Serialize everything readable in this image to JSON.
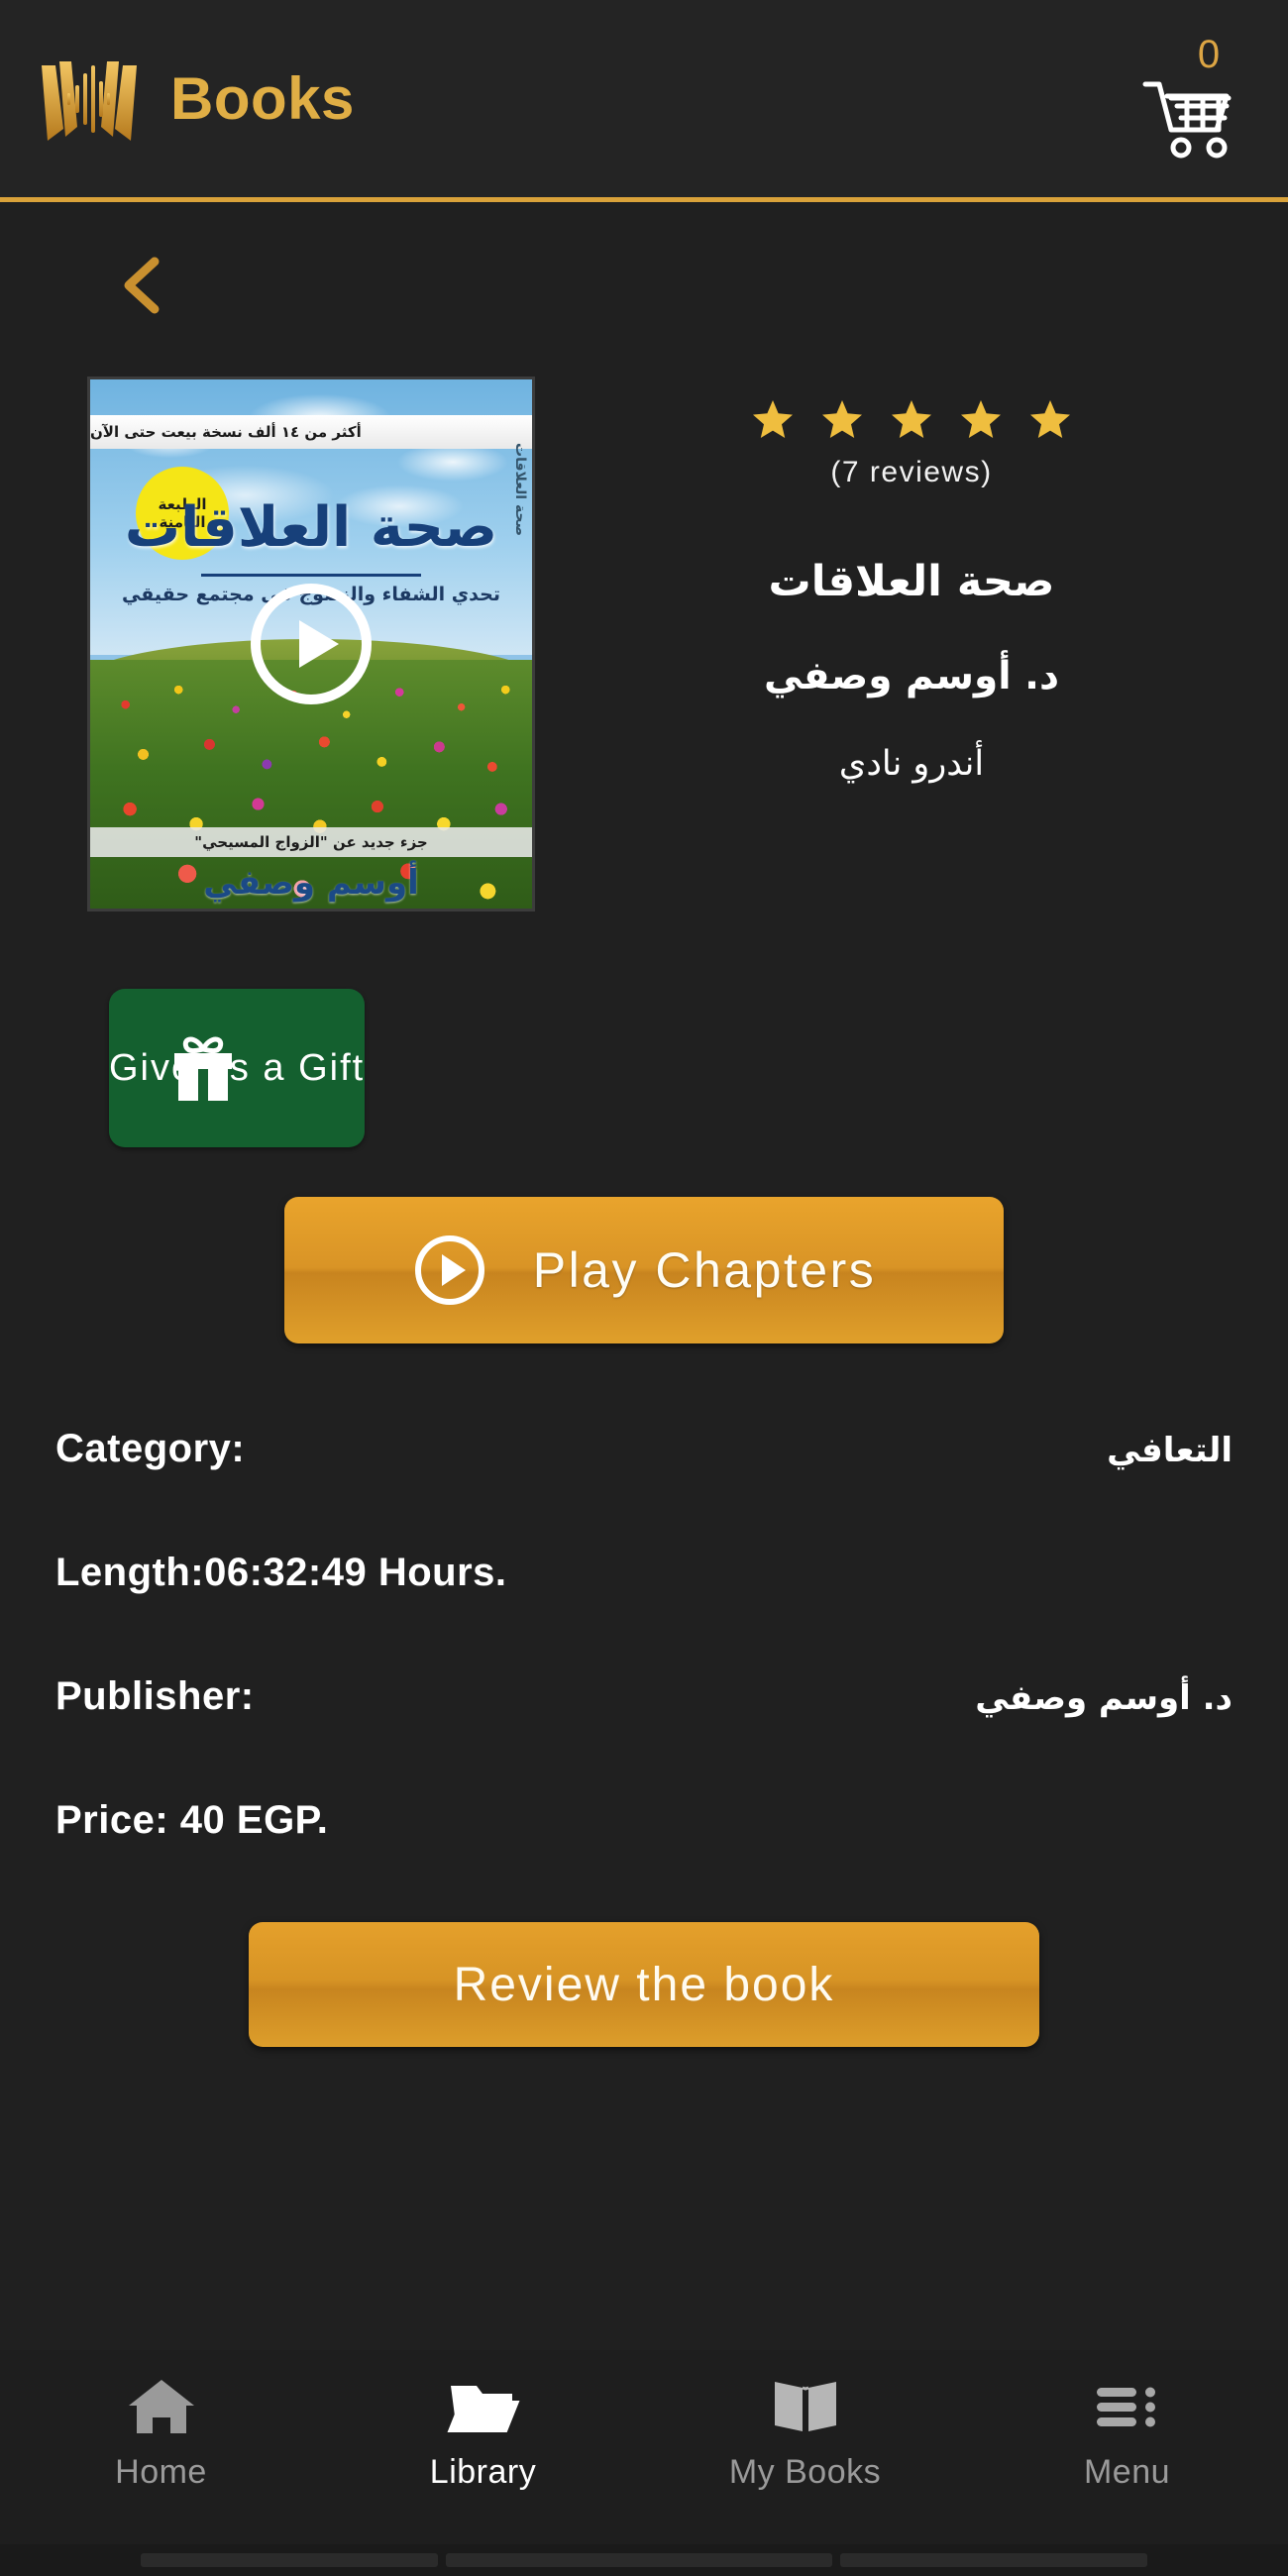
{
  "header": {
    "brand_title": "Books",
    "logo_icon": "open-book-audio-waveform-icon",
    "cart_icon": "shopping-cart-icon",
    "cart_count": "0",
    "accent_color": "#d9a23a",
    "brand_color": "#e0ae45"
  },
  "nav": {
    "back_icon": "chevron-left-icon"
  },
  "cover": {
    "play_overlay_icon": "play-circle-icon",
    "top_banner_ar": "أكثر من ١٤ ألف نسخة بيعت حتى الآن",
    "spine_ar": "صحة العلاقات",
    "badge_line1_ar": "الطبعة",
    "badge_line2_ar": "الثامنة",
    "title_ar": "صحة العلاقات",
    "subtitle_ar": "تحدي الشفاء والنضوج في مجتمع حقيقي",
    "footer_ar": "جزء جديد عن \"الزواج المسيحي\"",
    "author_ar": "أوسم وصفي"
  },
  "rating": {
    "stars_filled": 5,
    "star_icon": "star-filled-icon",
    "star_color": "#efbe3f",
    "reviews_text": "(7 reviews)"
  },
  "book": {
    "title_ar": "صحة  العلاقات",
    "author_ar": "د. أوسم وصفي",
    "narrator_ar": "أندرو نادي"
  },
  "actions": {
    "gift": {
      "label": "Give as a Gift",
      "icon": "gift-box-icon",
      "color": "#14602f"
    },
    "play_chapters": {
      "label": "Play Chapters",
      "icon": "play-circle-icon",
      "color": "#d99426"
    },
    "review": {
      "label": "Review the book",
      "color": "#d79425"
    }
  },
  "details": [
    {
      "label": "Category:",
      "value_ar": "التعافي"
    },
    {
      "label": "Length:06:32:49 Hours.",
      "value_ar": ""
    },
    {
      "label": "Publisher:",
      "value_ar": "د. أوسم وصفي"
    },
    {
      "label": "Price: 40 EGP.",
      "value_ar": ""
    }
  ],
  "bottom_nav": {
    "items": [
      {
        "label": "Home",
        "icon": "home-icon",
        "active": false
      },
      {
        "label": "Library",
        "icon": "folder-open-icon",
        "active": true
      },
      {
        "label": "My Books",
        "icon": "open-book-icon",
        "active": false
      },
      {
        "label": "Menu",
        "icon": "list-menu-icon",
        "active": false
      }
    ]
  }
}
